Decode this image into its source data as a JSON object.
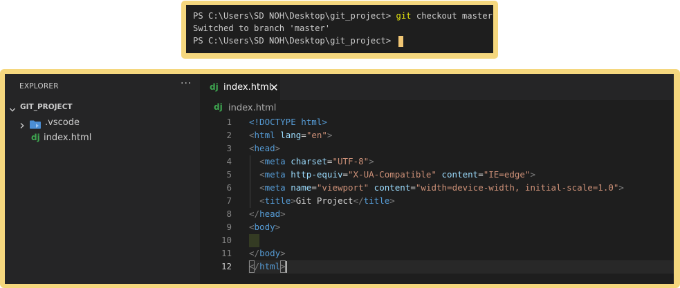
{
  "terminal": {
    "lines": [
      {
        "prompt": "PS C:\\Users\\SD NOH\\Desktop\\git_project> ",
        "command": "git",
        "args": " checkout master"
      },
      {
        "output": "Switched to branch 'master'"
      },
      {
        "prompt": "PS C:\\Users\\SD NOH\\Desktop\\git_project> "
      }
    ]
  },
  "explorer": {
    "title": "EXPLORER",
    "more_label": "···",
    "folder": "GIT_PROJECT",
    "items": [
      {
        "label": ".vscode",
        "type": "folder"
      },
      {
        "label": "index.html",
        "type": "file",
        "icon_text": "dj"
      }
    ]
  },
  "tab": {
    "label": "index.html",
    "icon_text": "dj",
    "close": "✕"
  },
  "breadcrumb": {
    "label": "index.html",
    "icon_text": "dj"
  },
  "editor": {
    "active_line": 12,
    "lines": [
      {
        "num": "1",
        "tokens": [
          [
            "doctype",
            "<!DOCTYPE html>"
          ]
        ]
      },
      {
        "num": "2",
        "tokens": [
          [
            "punct",
            "<"
          ],
          [
            "tag",
            "html"
          ],
          [
            "txt",
            " "
          ],
          [
            "attr",
            "lang"
          ],
          [
            "txt",
            "="
          ],
          [
            "str",
            "\"en\""
          ],
          [
            "punct",
            ">"
          ]
        ]
      },
      {
        "num": "3",
        "tokens": [
          [
            "punct",
            "<"
          ],
          [
            "tag",
            "head"
          ],
          [
            "punct",
            ">"
          ]
        ]
      },
      {
        "num": "4",
        "tokens": [
          [
            "txt",
            "  "
          ],
          [
            "punct",
            "<"
          ],
          [
            "tag",
            "meta"
          ],
          [
            "txt",
            " "
          ],
          [
            "attr",
            "charset"
          ],
          [
            "txt",
            "="
          ],
          [
            "str",
            "\"UTF-8\""
          ],
          [
            "punct",
            ">"
          ]
        ]
      },
      {
        "num": "5",
        "tokens": [
          [
            "txt",
            "  "
          ],
          [
            "punct",
            "<"
          ],
          [
            "tag",
            "meta"
          ],
          [
            "txt",
            " "
          ],
          [
            "attr",
            "http-equiv"
          ],
          [
            "txt",
            "="
          ],
          [
            "str",
            "\"X-UA-Compatible\""
          ],
          [
            "txt",
            " "
          ],
          [
            "attr",
            "content"
          ],
          [
            "txt",
            "="
          ],
          [
            "str",
            "\"IE=edge\""
          ],
          [
            "punct",
            ">"
          ]
        ]
      },
      {
        "num": "6",
        "tokens": [
          [
            "txt",
            "  "
          ],
          [
            "punct",
            "<"
          ],
          [
            "tag",
            "meta"
          ],
          [
            "txt",
            " "
          ],
          [
            "attr",
            "name"
          ],
          [
            "txt",
            "="
          ],
          [
            "str",
            "\"viewport\""
          ],
          [
            "txt",
            " "
          ],
          [
            "attr",
            "content"
          ],
          [
            "txt",
            "="
          ],
          [
            "str",
            "\"width=device-width, initial-scale=1.0\""
          ],
          [
            "punct",
            ">"
          ]
        ]
      },
      {
        "num": "7",
        "tokens": [
          [
            "txt",
            "  "
          ],
          [
            "punct",
            "<"
          ],
          [
            "tag",
            "title"
          ],
          [
            "punct",
            ">"
          ],
          [
            "txt",
            "Git Project"
          ],
          [
            "punct",
            "</"
          ],
          [
            "tag",
            "title"
          ],
          [
            "punct",
            ">"
          ]
        ]
      },
      {
        "num": "8",
        "tokens": [
          [
            "punct",
            "</"
          ],
          [
            "tag",
            "head"
          ],
          [
            "punct",
            ">"
          ]
        ]
      },
      {
        "num": "9",
        "tokens": [
          [
            "punct",
            "<"
          ],
          [
            "tag",
            "body"
          ],
          [
            "punct",
            ">"
          ]
        ]
      },
      {
        "num": "10",
        "tokens": []
      },
      {
        "num": "11",
        "tokens": [
          [
            "punct",
            "</"
          ],
          [
            "tag",
            "body"
          ],
          [
            "punct",
            ">"
          ]
        ]
      },
      {
        "num": "12",
        "tokens": [
          [
            "punct",
            "</"
          ],
          [
            "tag",
            "html"
          ],
          [
            "punct",
            ">"
          ]
        ]
      }
    ]
  },
  "colors": {
    "frame": "#f5d77e",
    "editor_bg": "#1e1e1e",
    "sidebar_bg": "#252526",
    "tag": "#569cd6",
    "attr": "#9cdcfe",
    "string": "#ce9178",
    "punct": "#808080",
    "django_icon": "#3ea650",
    "folder_icon": "#4b8ed4"
  }
}
